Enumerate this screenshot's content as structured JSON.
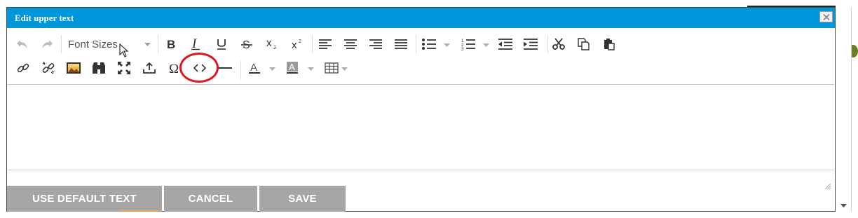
{
  "dialog": {
    "title": "Edit upper text",
    "close_label": "✕"
  },
  "toolbar": {
    "font_sizes_label": "Font Sizes",
    "row1": [
      "undo",
      "redo",
      "font-sizes",
      "bold",
      "italic",
      "underline",
      "strikethrough",
      "subscript",
      "superscript",
      "align-left",
      "align-center",
      "align-right",
      "justify",
      "bullet-list",
      "numbered-list",
      "outdent",
      "indent",
      "cut",
      "copy",
      "paste"
    ],
    "row2": [
      "link",
      "unlink",
      "image",
      "find",
      "fullscreen",
      "upload",
      "special-character",
      "source-code",
      "horizontal-rule",
      "text-color",
      "background-color",
      "table"
    ],
    "highlighted_button": "source-code"
  },
  "buttons": {
    "default_text": "USE DEFAULT TEXT",
    "cancel": "CANCEL",
    "save": "SAVE"
  },
  "colors": {
    "titlebar": "#0096db",
    "button_bg": "#a7a6a5",
    "highlight_circle": "#e2141c"
  }
}
